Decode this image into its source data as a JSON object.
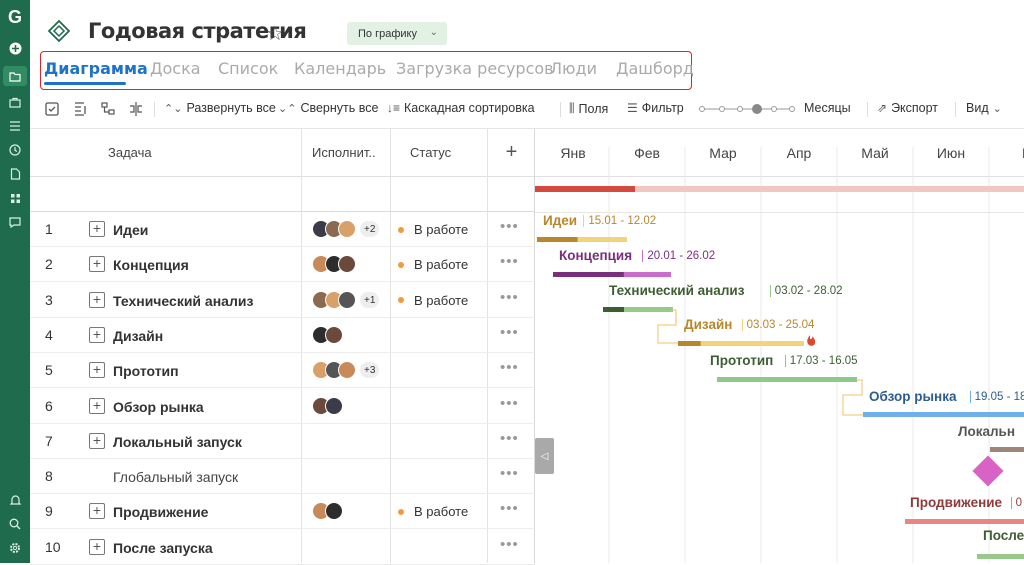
{
  "app": {
    "logo": "G"
  },
  "project": {
    "title": "Годовая стратегия",
    "schedule_status": "По графику"
  },
  "tabs": [
    "Диаграмма",
    "Доска",
    "Список",
    "Календарь",
    "Загрузка ресурсов",
    "Люди",
    "Дашборд"
  ],
  "toolbar": {
    "expand_all": "Развернуть все",
    "collapse_all": "Свернуть все",
    "cascade_sort": "Каскадная сортировка",
    "fields": "Поля",
    "filter": "Фильтр",
    "zoom_label": "Месяцы",
    "export": "Экспорт",
    "view": "Вид"
  },
  "grid": {
    "headers": {
      "task": "Задача",
      "assignee": "Исполнит..",
      "status": "Статус",
      "add": "+"
    },
    "rows": [
      {
        "num": "1",
        "name": "Идеи",
        "expandable": true,
        "avatars": 3,
        "more": "+2",
        "status": "В работе"
      },
      {
        "num": "2",
        "name": "Концепция",
        "expandable": true,
        "avatars": 3,
        "more": "",
        "status": "В работе"
      },
      {
        "num": "3",
        "name": "Технический анализ",
        "expandable": true,
        "avatars": 3,
        "more": "+1",
        "status": "В работе"
      },
      {
        "num": "4",
        "name": "Дизайн",
        "expandable": true,
        "avatars": 2,
        "more": "",
        "status": ""
      },
      {
        "num": "5",
        "name": "Прототип",
        "expandable": true,
        "avatars": 3,
        "more": "+3",
        "status": ""
      },
      {
        "num": "6",
        "name": "Обзор рынка",
        "expandable": true,
        "avatars": 2,
        "more": "",
        "status": ""
      },
      {
        "num": "7",
        "name": "Локальный запуск",
        "expandable": true,
        "avatars": 0,
        "more": "",
        "status": ""
      },
      {
        "num": "8",
        "name": "Глобальный запуск",
        "expandable": false,
        "avatars": 0,
        "more": "",
        "status": ""
      },
      {
        "num": "9",
        "name": "Продвижение",
        "expandable": true,
        "avatars": 2,
        "more": "",
        "status": "В работе"
      },
      {
        "num": "10",
        "name": "После запуска",
        "expandable": true,
        "avatars": 0,
        "more": "",
        "status": ""
      }
    ]
  },
  "gantt": {
    "months": [
      "Янв",
      "Фев",
      "Мар",
      "Апр",
      "Май",
      "Июн",
      "И"
    ],
    "tasks": [
      {
        "name": "Идеи",
        "dates": "15.01 - 12.02",
        "color": "#b8872a",
        "light": "#f2d27a"
      },
      {
        "name": "Концепция",
        "dates": "20.01 - 26.02",
        "color": "#7a2f7e",
        "light": "#c96ccb"
      },
      {
        "name": "Технический анализ",
        "dates": "03.02 - 28.02",
        "color": "#3d5d33",
        "light": "#96c98a"
      },
      {
        "name": "Дизайн",
        "dates": "03.03 - 25.04",
        "color": "#b8872a",
        "light": "#f2d27a"
      },
      {
        "name": "Прототип",
        "dates": "17.03 - 16.05",
        "color": "#3d5d33",
        "light": "#8fc88a"
      },
      {
        "name": "Обзор рынка",
        "dates": "19.05 - 18",
        "color": "#2c5d8f",
        "light": "#6fb0e8"
      },
      {
        "name": "Локальн",
        "dates": "",
        "color": "#555",
        "light": "#9e857c"
      },
      {
        "name": "Продвижение",
        "dates": "0",
        "color": "#8f3a3a",
        "light": "#ea8585"
      },
      {
        "name": "После",
        "dates": "",
        "color": "#3d5d33",
        "light": "#96c98a"
      }
    ],
    "summary_colors": {
      "done": "#d44a3e",
      "rest": "#f2c7c2"
    },
    "milestone_color": "#d863c4"
  }
}
